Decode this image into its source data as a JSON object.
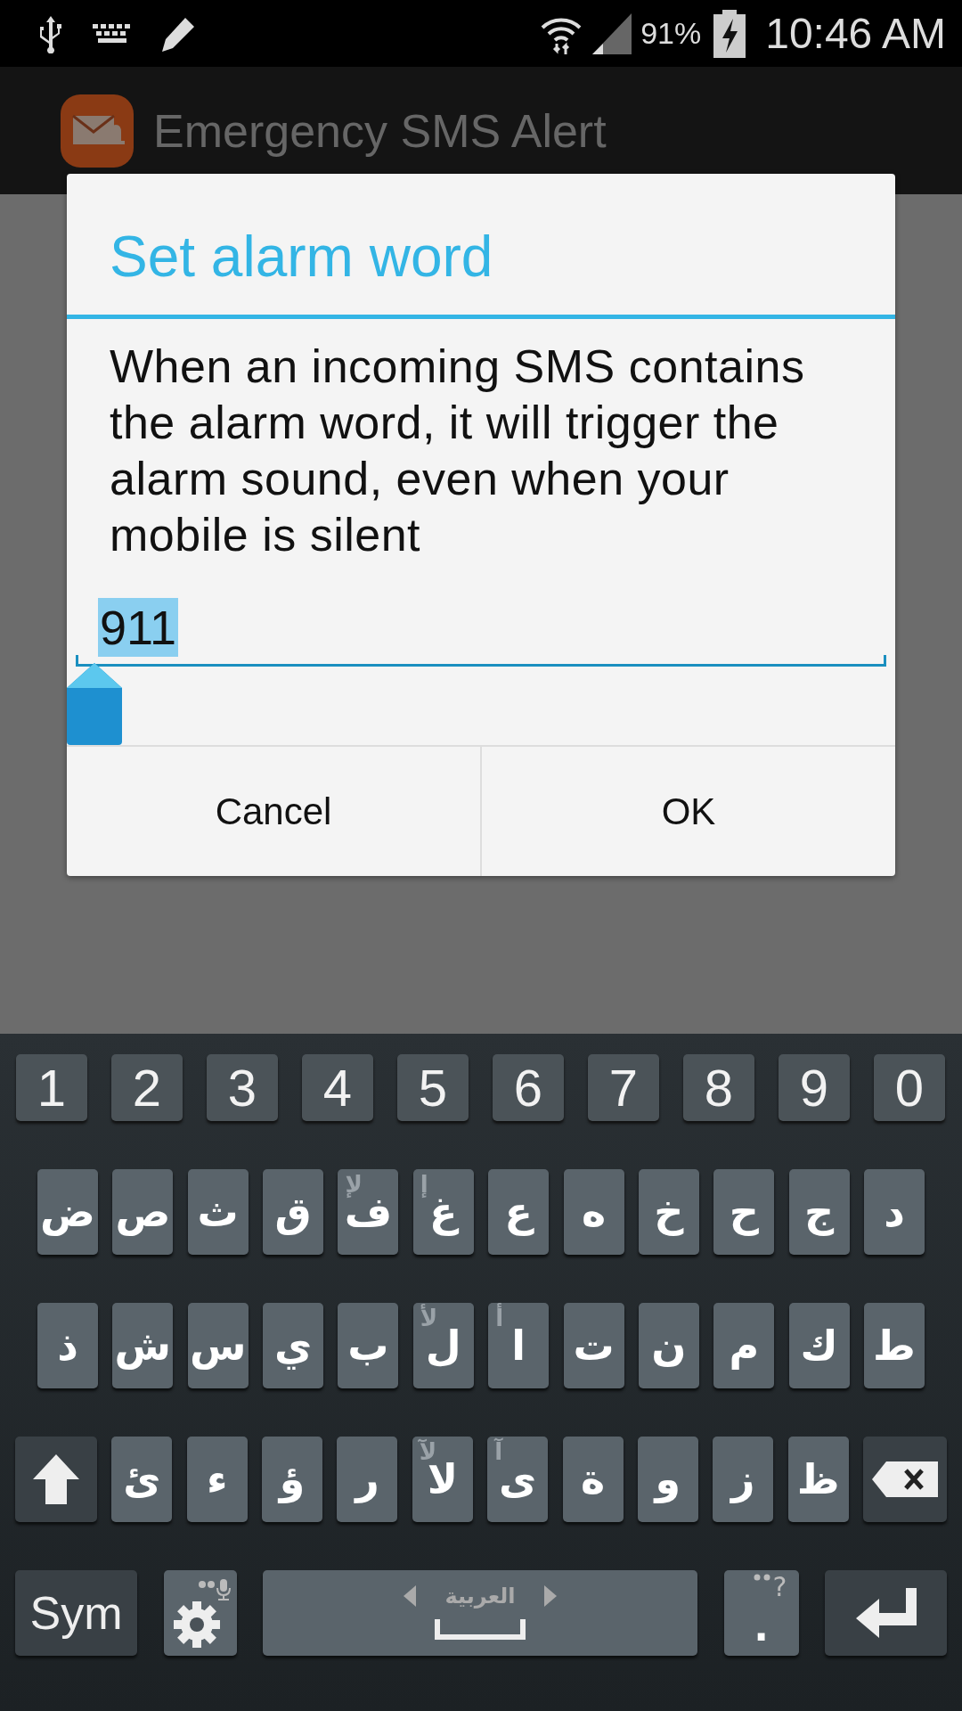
{
  "status_bar": {
    "battery": "91%",
    "time": "10:46 AM"
  },
  "app_bar": {
    "title": "Emergency SMS Alert"
  },
  "dialog": {
    "title": "Set alarm word",
    "message": "When an incoming SMS contains the alarm word, it will trigger the alarm sound, even when your mobile is silent",
    "input": {
      "value": "911",
      "selected": true
    },
    "buttons": [
      "Cancel",
      "OK"
    ]
  },
  "keyboard": {
    "number_row": [
      "1",
      "2",
      "3",
      "4",
      "5",
      "6",
      "7",
      "8",
      "9",
      "0"
    ],
    "rows": [
      [
        {
          "kind": "char",
          "label": "ض"
        },
        {
          "kind": "char",
          "label": "ص"
        },
        {
          "kind": "char",
          "label": "ث"
        },
        {
          "kind": "char",
          "label": "ق"
        },
        {
          "kind": "char",
          "label": "ف",
          "hint": "لإ"
        },
        {
          "kind": "char",
          "label": "غ",
          "hint": "إ"
        },
        {
          "kind": "char",
          "label": "ع"
        },
        {
          "kind": "char",
          "label": "ه"
        },
        {
          "kind": "char",
          "label": "خ"
        },
        {
          "kind": "char",
          "label": "ح"
        },
        {
          "kind": "char",
          "label": "ج"
        },
        {
          "kind": "char",
          "label": "د"
        }
      ],
      [
        {
          "kind": "char",
          "label": "ذ"
        },
        {
          "kind": "char",
          "label": "ش"
        },
        {
          "kind": "char",
          "label": "س"
        },
        {
          "kind": "char",
          "label": "ي"
        },
        {
          "kind": "char",
          "label": "ب"
        },
        {
          "kind": "char",
          "label": "ل",
          "hint": "لأ"
        },
        {
          "kind": "char",
          "label": "ا",
          "hint": "أ"
        },
        {
          "kind": "char",
          "label": "ت"
        },
        {
          "kind": "char",
          "label": "ن"
        },
        {
          "kind": "char",
          "label": "م"
        },
        {
          "kind": "char",
          "label": "ك"
        },
        {
          "kind": "char",
          "label": "ط"
        }
      ],
      [
        {
          "kind": "shift"
        },
        {
          "kind": "char",
          "label": "ئ"
        },
        {
          "kind": "char",
          "label": "ء"
        },
        {
          "kind": "char",
          "label": "ؤ"
        },
        {
          "kind": "char",
          "label": "ر"
        },
        {
          "kind": "char",
          "label": "لا",
          "hint": "لآ"
        },
        {
          "kind": "char",
          "label": "ى",
          "hint": "آ"
        },
        {
          "kind": "char",
          "label": "ة"
        },
        {
          "kind": "char",
          "label": "و"
        },
        {
          "kind": "char",
          "label": "ز"
        },
        {
          "kind": "char",
          "label": "ظ"
        },
        {
          "kind": "backspace"
        }
      ],
      [
        {
          "kind": "sym",
          "label": "Sym"
        },
        {
          "kind": "settings"
        },
        {
          "kind": "space",
          "label": "العربية"
        },
        {
          "kind": "punct",
          "label": ".",
          "hint": "?"
        },
        {
          "kind": "enter"
        }
      ]
    ]
  }
}
